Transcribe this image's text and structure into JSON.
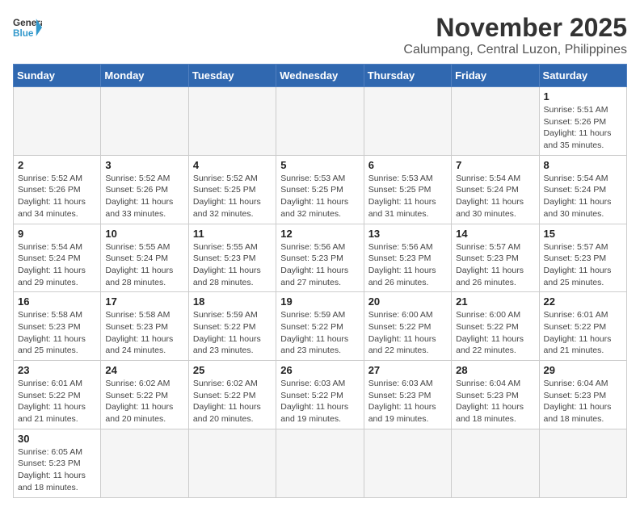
{
  "header": {
    "logo_general": "General",
    "logo_blue": "Blue",
    "month_title": "November 2025",
    "location": "Calumpang, Central Luzon, Philippines"
  },
  "weekdays": [
    "Sunday",
    "Monday",
    "Tuesday",
    "Wednesday",
    "Thursday",
    "Friday",
    "Saturday"
  ],
  "weeks": [
    [
      {
        "day": null,
        "info": null
      },
      {
        "day": null,
        "info": null
      },
      {
        "day": null,
        "info": null
      },
      {
        "day": null,
        "info": null
      },
      {
        "day": null,
        "info": null
      },
      {
        "day": null,
        "info": null
      },
      {
        "day": "1",
        "info": "Sunrise: 5:51 AM\nSunset: 5:26 PM\nDaylight: 11 hours\nand 35 minutes."
      }
    ],
    [
      {
        "day": "2",
        "info": "Sunrise: 5:52 AM\nSunset: 5:26 PM\nDaylight: 11 hours\nand 34 minutes."
      },
      {
        "day": "3",
        "info": "Sunrise: 5:52 AM\nSunset: 5:26 PM\nDaylight: 11 hours\nand 33 minutes."
      },
      {
        "day": "4",
        "info": "Sunrise: 5:52 AM\nSunset: 5:25 PM\nDaylight: 11 hours\nand 32 minutes."
      },
      {
        "day": "5",
        "info": "Sunrise: 5:53 AM\nSunset: 5:25 PM\nDaylight: 11 hours\nand 32 minutes."
      },
      {
        "day": "6",
        "info": "Sunrise: 5:53 AM\nSunset: 5:25 PM\nDaylight: 11 hours\nand 31 minutes."
      },
      {
        "day": "7",
        "info": "Sunrise: 5:54 AM\nSunset: 5:24 PM\nDaylight: 11 hours\nand 30 minutes."
      },
      {
        "day": "8",
        "info": "Sunrise: 5:54 AM\nSunset: 5:24 PM\nDaylight: 11 hours\nand 30 minutes."
      }
    ],
    [
      {
        "day": "9",
        "info": "Sunrise: 5:54 AM\nSunset: 5:24 PM\nDaylight: 11 hours\nand 29 minutes."
      },
      {
        "day": "10",
        "info": "Sunrise: 5:55 AM\nSunset: 5:24 PM\nDaylight: 11 hours\nand 28 minutes."
      },
      {
        "day": "11",
        "info": "Sunrise: 5:55 AM\nSunset: 5:23 PM\nDaylight: 11 hours\nand 28 minutes."
      },
      {
        "day": "12",
        "info": "Sunrise: 5:56 AM\nSunset: 5:23 PM\nDaylight: 11 hours\nand 27 minutes."
      },
      {
        "day": "13",
        "info": "Sunrise: 5:56 AM\nSunset: 5:23 PM\nDaylight: 11 hours\nand 26 minutes."
      },
      {
        "day": "14",
        "info": "Sunrise: 5:57 AM\nSunset: 5:23 PM\nDaylight: 11 hours\nand 26 minutes."
      },
      {
        "day": "15",
        "info": "Sunrise: 5:57 AM\nSunset: 5:23 PM\nDaylight: 11 hours\nand 25 minutes."
      }
    ],
    [
      {
        "day": "16",
        "info": "Sunrise: 5:58 AM\nSunset: 5:23 PM\nDaylight: 11 hours\nand 25 minutes."
      },
      {
        "day": "17",
        "info": "Sunrise: 5:58 AM\nSunset: 5:23 PM\nDaylight: 11 hours\nand 24 minutes."
      },
      {
        "day": "18",
        "info": "Sunrise: 5:59 AM\nSunset: 5:22 PM\nDaylight: 11 hours\nand 23 minutes."
      },
      {
        "day": "19",
        "info": "Sunrise: 5:59 AM\nSunset: 5:22 PM\nDaylight: 11 hours\nand 23 minutes."
      },
      {
        "day": "20",
        "info": "Sunrise: 6:00 AM\nSunset: 5:22 PM\nDaylight: 11 hours\nand 22 minutes."
      },
      {
        "day": "21",
        "info": "Sunrise: 6:00 AM\nSunset: 5:22 PM\nDaylight: 11 hours\nand 22 minutes."
      },
      {
        "day": "22",
        "info": "Sunrise: 6:01 AM\nSunset: 5:22 PM\nDaylight: 11 hours\nand 21 minutes."
      }
    ],
    [
      {
        "day": "23",
        "info": "Sunrise: 6:01 AM\nSunset: 5:22 PM\nDaylight: 11 hours\nand 21 minutes."
      },
      {
        "day": "24",
        "info": "Sunrise: 6:02 AM\nSunset: 5:22 PM\nDaylight: 11 hours\nand 20 minutes."
      },
      {
        "day": "25",
        "info": "Sunrise: 6:02 AM\nSunset: 5:22 PM\nDaylight: 11 hours\nand 20 minutes."
      },
      {
        "day": "26",
        "info": "Sunrise: 6:03 AM\nSunset: 5:22 PM\nDaylight: 11 hours\nand 19 minutes."
      },
      {
        "day": "27",
        "info": "Sunrise: 6:03 AM\nSunset: 5:23 PM\nDaylight: 11 hours\nand 19 minutes."
      },
      {
        "day": "28",
        "info": "Sunrise: 6:04 AM\nSunset: 5:23 PM\nDaylight: 11 hours\nand 18 minutes."
      },
      {
        "day": "29",
        "info": "Sunrise: 6:04 AM\nSunset: 5:23 PM\nDaylight: 11 hours\nand 18 minutes."
      }
    ],
    [
      {
        "day": "30",
        "info": "Sunrise: 6:05 AM\nSunset: 5:23 PM\nDaylight: 11 hours\nand 18 minutes."
      },
      {
        "day": null,
        "info": null
      },
      {
        "day": null,
        "info": null
      },
      {
        "day": null,
        "info": null
      },
      {
        "day": null,
        "info": null
      },
      {
        "day": null,
        "info": null
      },
      {
        "day": null,
        "info": null
      }
    ]
  ]
}
